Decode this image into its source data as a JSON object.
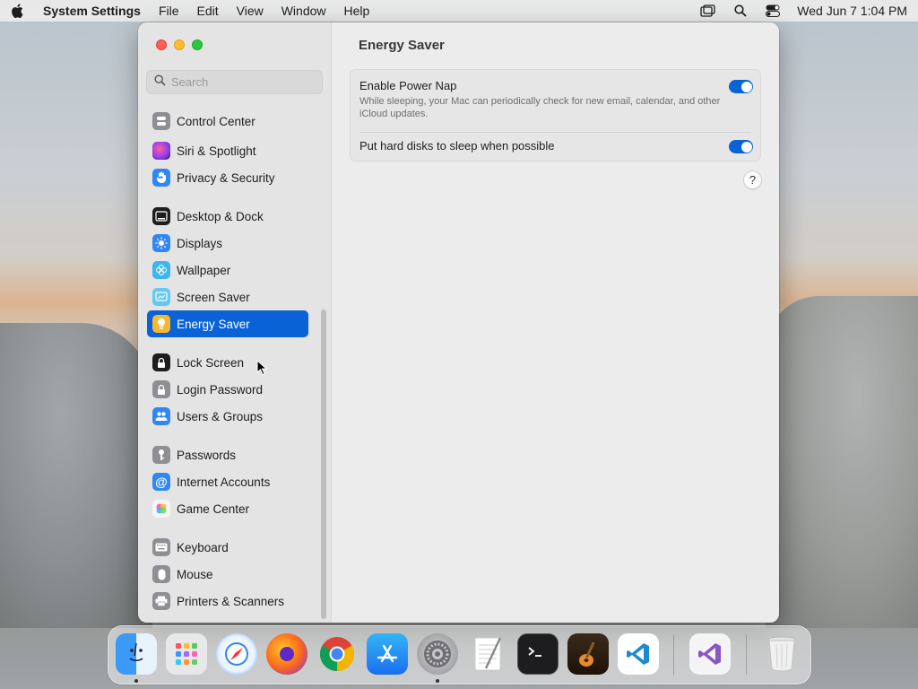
{
  "menubar": {
    "app_name": "System Settings",
    "items": [
      "File",
      "Edit",
      "View",
      "Window",
      "Help"
    ],
    "clock": "Wed Jun 7  1:04 PM"
  },
  "search": {
    "placeholder": "Search"
  },
  "sidebar": {
    "items": [
      {
        "label": "Control Center",
        "icon": "control-center-icon",
        "color": "#8e8e93"
      },
      {
        "label": "Siri & Spotlight",
        "icon": "siri-icon",
        "color": "#8b3cf0"
      },
      {
        "label": "Privacy & Security",
        "icon": "hand-icon",
        "color": "#2f87f5"
      },
      {
        "label": "Desktop & Dock",
        "icon": "dock-icon",
        "color": "#1d1d1f"
      },
      {
        "label": "Displays",
        "icon": "sun-icon",
        "color": "#2f87f5"
      },
      {
        "label": "Wallpaper",
        "icon": "flower-icon",
        "color": "#3fb5f0"
      },
      {
        "label": "Screen Saver",
        "icon": "screen-saver-icon",
        "color": "#62c9f5"
      },
      {
        "label": "Energy Saver",
        "icon": "bulb-icon",
        "color": "#f5b82e"
      },
      {
        "label": "Lock Screen",
        "icon": "lock-icon",
        "color": "#1d1d1f"
      },
      {
        "label": "Login Password",
        "icon": "padlock-icon",
        "color": "#8e8e93"
      },
      {
        "label": "Users & Groups",
        "icon": "users-icon",
        "color": "#2f87f5"
      },
      {
        "label": "Passwords",
        "icon": "key-icon",
        "color": "#8e8e93"
      },
      {
        "label": "Internet Accounts",
        "icon": "at-icon",
        "color": "#2f87f5"
      },
      {
        "label": "Game Center",
        "icon": "game-center-icon",
        "color": "#f0f0f0"
      },
      {
        "label": "Keyboard",
        "icon": "keyboard-icon",
        "color": "#8e8e93"
      },
      {
        "label": "Mouse",
        "icon": "mouse-icon",
        "color": "#8e8e93"
      },
      {
        "label": "Printers & Scanners",
        "icon": "printer-icon",
        "color": "#8e8e93"
      }
    ]
  },
  "content": {
    "title": "Energy Saver",
    "power_nap": {
      "label": "Enable Power Nap",
      "description": "While sleeping, your Mac can periodically check for new email, calendar, and other iCloud updates.",
      "enabled": true
    },
    "disk_sleep": {
      "label": "Put hard disks to sleep when possible",
      "enabled": true
    },
    "help_label": "?"
  },
  "dock": {
    "apps": [
      "Finder",
      "Launchpad",
      "Safari",
      "Firefox",
      "Chrome",
      "App Store",
      "System Settings",
      "TextEdit",
      "Terminal",
      "GarageBand",
      "VS Code",
      "Visual Studio",
      "Trash"
    ]
  },
  "colors": {
    "accent": "#0a63d6"
  }
}
